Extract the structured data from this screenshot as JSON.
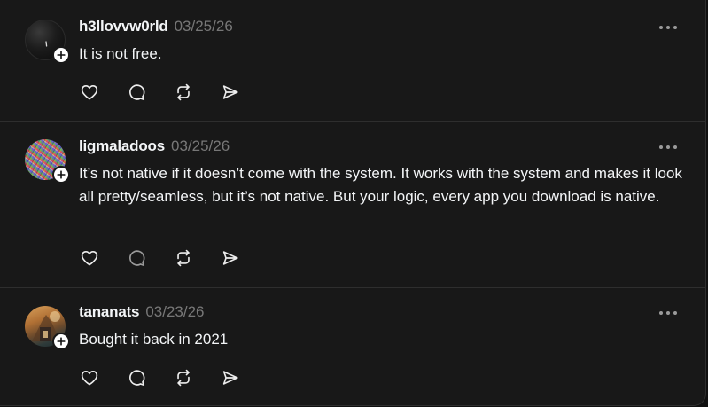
{
  "posts": [
    {
      "username": "h3llovvw0rld",
      "timestamp": "03/25/26",
      "text": "It is not free.",
      "avatar": "dark-circle-avatar"
    },
    {
      "username": "ligmaladoos",
      "timestamp": "03/25/26",
      "text": "It’s not native if it doesn’t come with the system. It works with the system and makes it look all pretty/seamless, but it’s not native. But your logic, every app you download is native.",
      "avatar": "colorful-noise-avatar"
    },
    {
      "username": "tananats",
      "timestamp": "03/23/26",
      "text": "Bought it back in 2021",
      "avatar": "photo-avatar"
    }
  ],
  "icons": {
    "follow": "plus-icon",
    "more": "more-dots-icon",
    "like": "heart-icon",
    "reply": "comment-icon",
    "repost": "repost-icon",
    "share": "send-icon"
  },
  "colors": {
    "background": "#181818",
    "text": "#f3f5f7",
    "muted": "#777777",
    "divider": "#2e2e2e"
  }
}
